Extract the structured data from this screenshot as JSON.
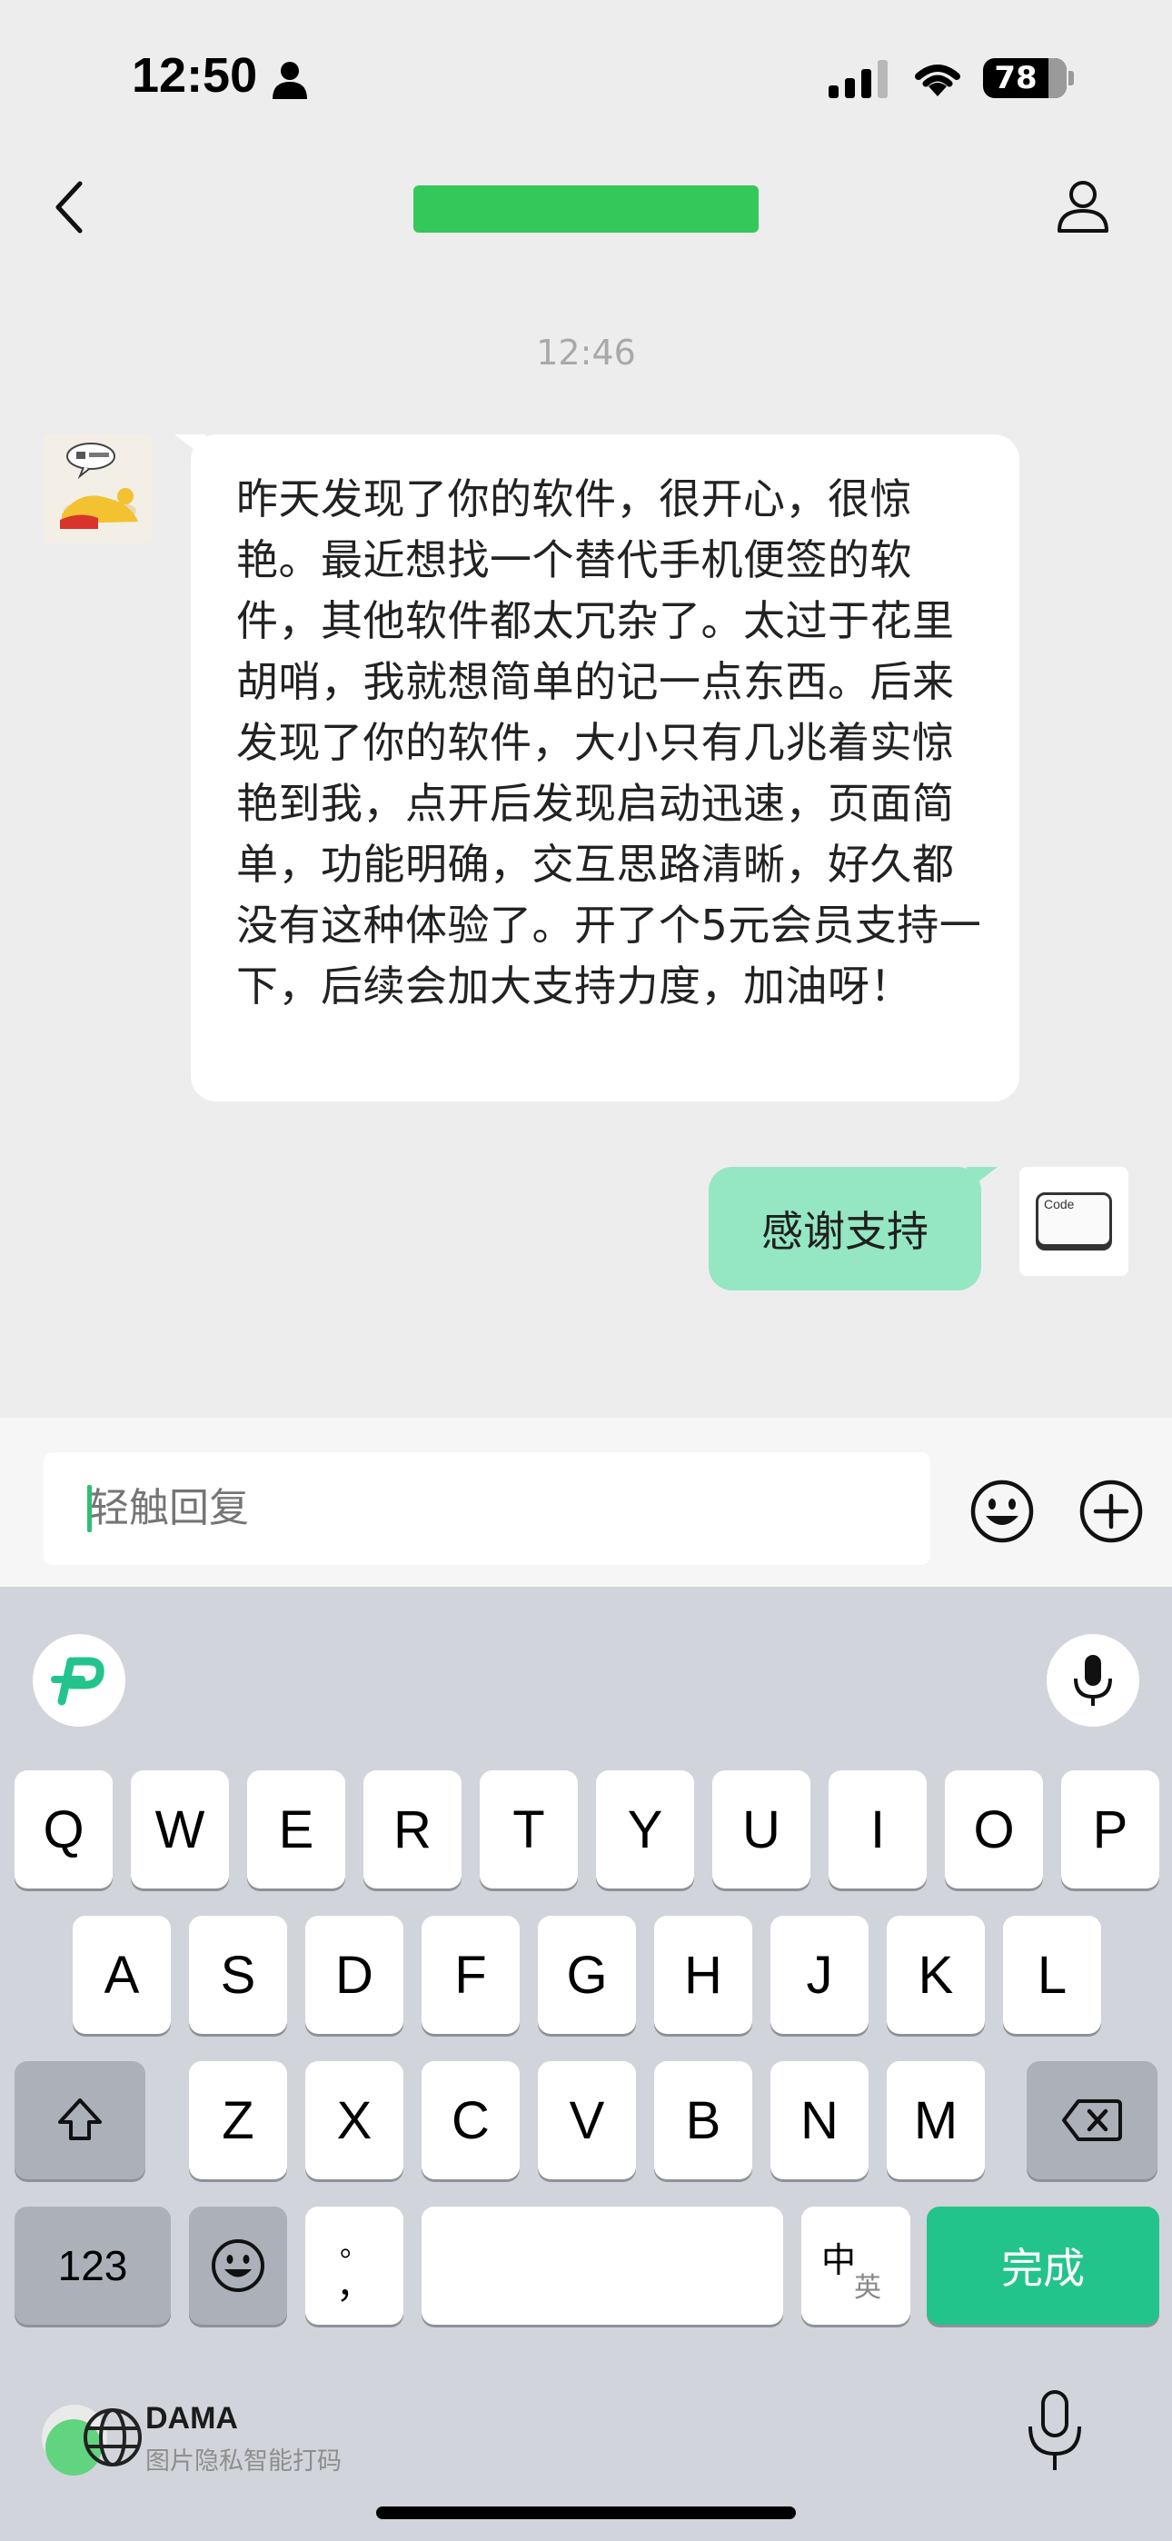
{
  "status_bar": {
    "time": "12:50",
    "battery": "78"
  },
  "header": {
    "back_icon": "chevron-left-icon",
    "title_color": "#34c759",
    "profile_icon": "person-icon"
  },
  "conversation": {
    "timestamp": "12:46",
    "incoming": {
      "text": "昨天发现了你的软件，很开心，很惊艳。最近想找一个替代手机便签的软件，其他软件都太冗杂了。太过于花里胡哨，我就想简单的记一点东西。后来发现了你的软件，大小只有几兆着实惊艳到我，点开后发现启动迅速，页面简单，功能明确，交互思路清晰，好久都没有这种体验了。开了个5元会员支持一下，后续会加大支持力度，加油呀！"
    },
    "outgoing": {
      "text": "感谢支持",
      "avatar_label": "Code"
    }
  },
  "composer": {
    "placeholder": "轻触回复",
    "emoji_icon": "smiley-icon",
    "add_icon": "plus-circle-icon"
  },
  "keyboard": {
    "row1": [
      "Q",
      "W",
      "E",
      "R",
      "T",
      "Y",
      "U",
      "I",
      "O",
      "P"
    ],
    "row2": [
      "A",
      "S",
      "D",
      "F",
      "G",
      "H",
      "J",
      "K",
      "L"
    ],
    "row3": [
      "Z",
      "X",
      "C",
      "V",
      "B",
      "N",
      "M"
    ],
    "numbers_label": "123",
    "punct_top": "。",
    "punct_bottom": "，",
    "lang_zh": "中",
    "lang_en": "英",
    "done_label": "完成",
    "accent_color": "#23c48b"
  },
  "watermark": {
    "title": "DAMA",
    "subtitle": "图片隐私智能打码"
  }
}
